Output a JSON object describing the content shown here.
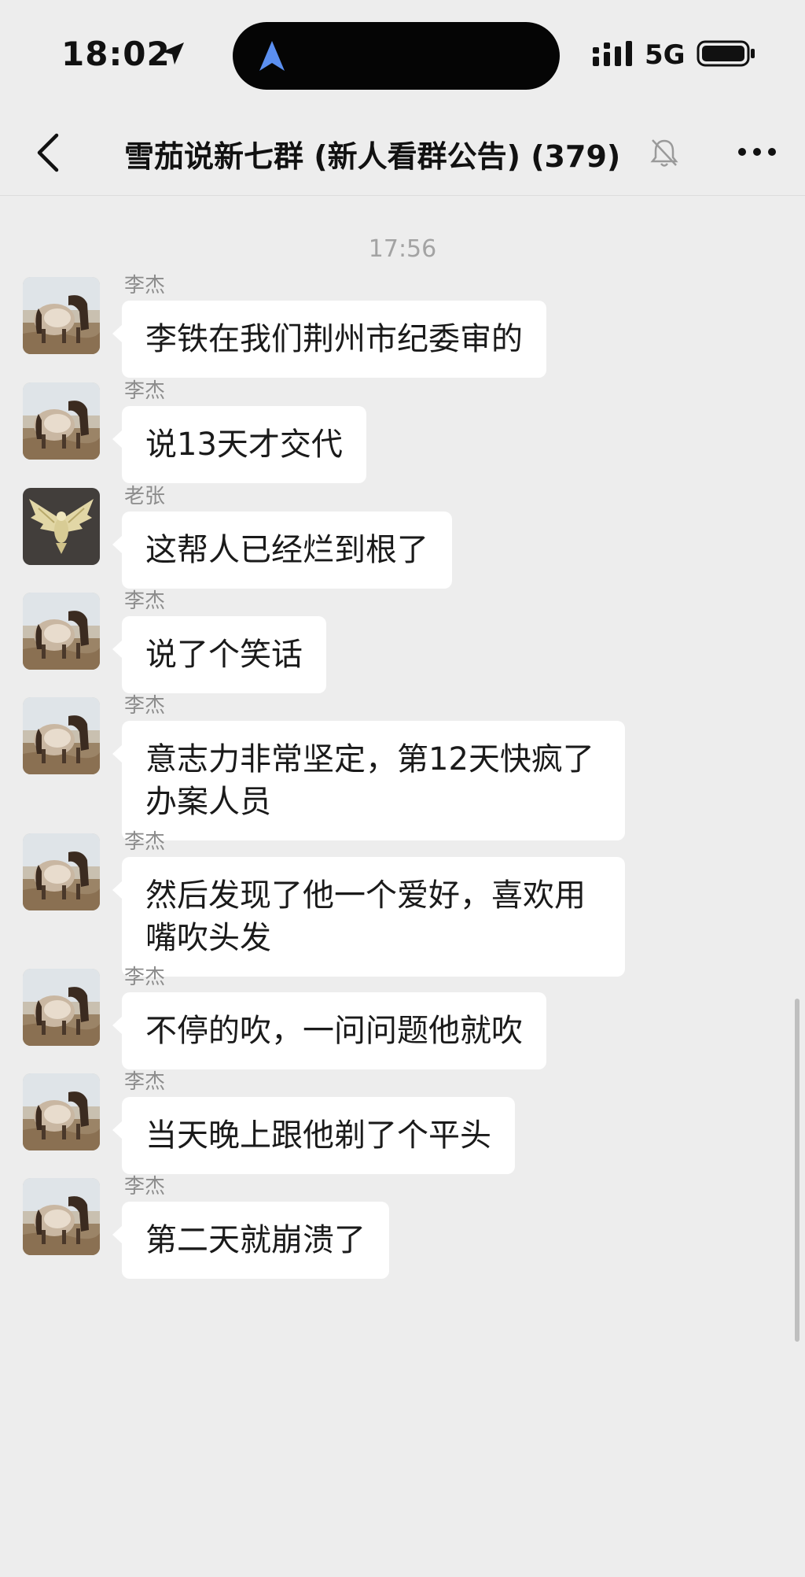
{
  "status_bar": {
    "time": "18:02",
    "network": "5G",
    "icons": [
      "location-arrow-icon",
      "navigation-icon",
      "signal-icon",
      "battery-icon"
    ]
  },
  "nav_bar": {
    "title": "雪茄说新七群 (新人看群公告) (379)",
    "icons": [
      "back-chevron-icon",
      "mute-bell-icon",
      "more-dots-icon"
    ]
  },
  "chat": {
    "timestamp": "17:56",
    "messages": [
      {
        "sender": "李杰",
        "text": "李铁在我们荆州市纪委审的",
        "avatar": "horse"
      },
      {
        "sender": "李杰",
        "text": "说13天才交代",
        "avatar": "horse"
      },
      {
        "sender": "老张",
        "text": "这帮人已经烂到根了",
        "avatar": "eagle"
      },
      {
        "sender": "李杰",
        "text": "说了个笑话",
        "avatar": "horse"
      },
      {
        "sender": "李杰",
        "text": "意志力非常坚定，第12天快疯了办案人员",
        "avatar": "horse"
      },
      {
        "sender": "李杰",
        "text": "然后发现了他一个爱好，喜欢用嘴吹头发",
        "avatar": "horse"
      },
      {
        "sender": "李杰",
        "text": "不停的吹，一问问题他就吹",
        "avatar": "horse"
      },
      {
        "sender": "李杰",
        "text": "当天晚上跟他剃了个平头",
        "avatar": "horse"
      },
      {
        "sender": "李杰",
        "text": "第二天就崩溃了",
        "avatar": "horse"
      }
    ]
  },
  "colors": {
    "background": "#ededed",
    "bubble": "#ffffff",
    "sender_name": "#8c8c8c",
    "timestamp": "#a3a3a3"
  }
}
